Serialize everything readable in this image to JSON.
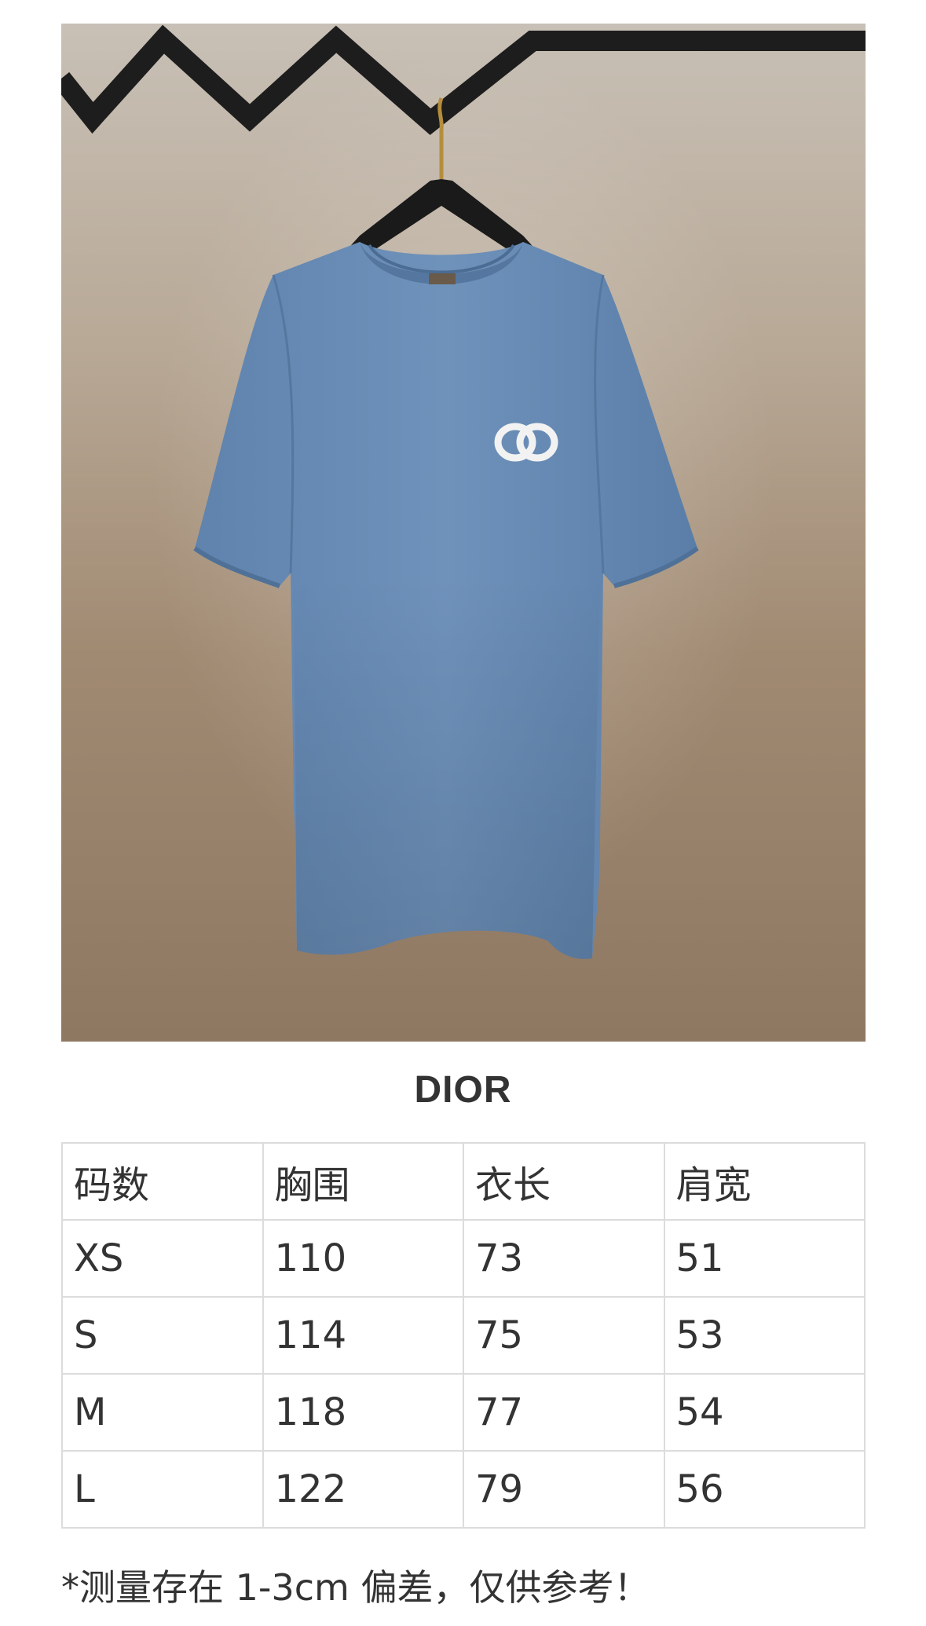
{
  "brand": "DIOR",
  "size_table": {
    "headers": [
      "码数",
      "胸围",
      "衣长",
      "肩宽"
    ],
    "rows": [
      [
        "XS",
        "110",
        "73",
        "51"
      ],
      [
        "S",
        "114",
        "75",
        "53"
      ],
      [
        "M",
        "118",
        "77",
        "54"
      ],
      [
        "L",
        "122",
        "79",
        "56"
      ]
    ]
  },
  "note": "*测量存在 1-3cm 偏差，仅供参考！",
  "product_photo": {
    "subject": "tshirt-on-hanger",
    "shirt_color": "#6b8db5",
    "logo_color": "#f2f2f2"
  }
}
